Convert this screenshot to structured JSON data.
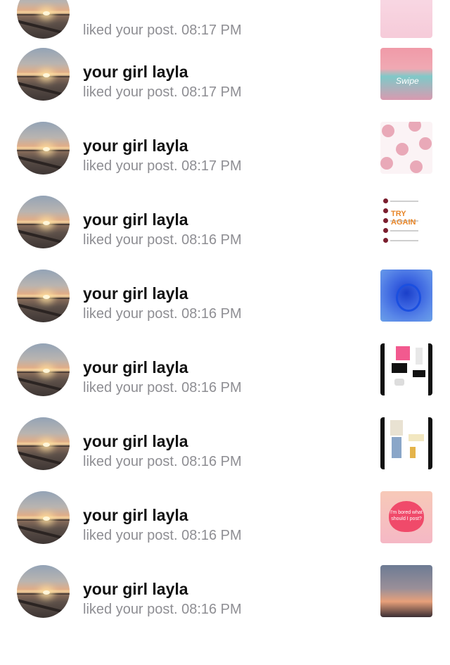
{
  "notifications": [
    {
      "username": "",
      "action": "liked your post.",
      "time": "08:17 PM",
      "thumb": "pink"
    },
    {
      "username": "your girl layla",
      "action": "liked your post.",
      "time": "08:17 PM",
      "thumb": "beach",
      "thumb_text": "Swipe"
    },
    {
      "username": "your girl layla",
      "action": "liked your post.",
      "time": "08:17 PM",
      "thumb": "dots"
    },
    {
      "username": "your girl layla",
      "action": "liked your post.",
      "time": "08:16 PM",
      "thumb": "list",
      "thumb_text": "TRY AGAIN"
    },
    {
      "username": "your girl layla",
      "action": "liked your post.",
      "time": "08:16 PM",
      "thumb": "blue"
    },
    {
      "username": "your girl layla",
      "action": "liked your post.",
      "time": "08:16 PM",
      "thumb": "fashion1"
    },
    {
      "username": "your girl layla",
      "action": "liked your post.",
      "time": "08:16 PM",
      "thumb": "fashion2"
    },
    {
      "username": "your girl layla",
      "action": "liked your post.",
      "time": "08:16 PM",
      "thumb": "heart",
      "thumb_text": "I'm bored what should I post?"
    },
    {
      "username": "your girl layla",
      "action": "liked your post.",
      "time": "08:16 PM",
      "thumb": "sunset"
    }
  ]
}
